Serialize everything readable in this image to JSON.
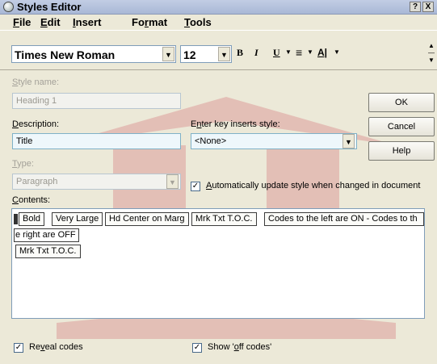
{
  "window": {
    "title": "Styles Editor",
    "help_btn": "?",
    "close_btn": "X"
  },
  "menu": {
    "file": {
      "u": "F",
      "rest": "ile"
    },
    "edit": {
      "u": "E",
      "rest": "dit"
    },
    "insert": {
      "u": "I",
      "rest": "nsert"
    },
    "format": {
      "pre": "Fo",
      "u": "r",
      "rest": "mat"
    },
    "tools": {
      "u": "T",
      "rest": "ools"
    }
  },
  "toolbar": {
    "font": "Times New Roman",
    "size": "12",
    "bold": "B",
    "italic": "I",
    "underline": "U"
  },
  "form": {
    "style_name_label": {
      "u": "S",
      "rest": "tyle name:"
    },
    "style_name_value": "Heading 1",
    "description_label": {
      "u": "D",
      "rest": "escription:"
    },
    "description_value": "Title",
    "enter_key_label": {
      "pre": "E",
      "u": "n",
      "rest": "ter key inserts style:"
    },
    "enter_key_value": "<None>",
    "type_label": {
      "u": "T",
      "rest": "ype:"
    },
    "type_value": "Paragraph",
    "auto_update_label": {
      "u": "A",
      "rest": "utomatically update style when changed in document"
    },
    "auto_update_checked": true,
    "contents_label": {
      "u": "C",
      "rest": "ontents:"
    }
  },
  "buttons": {
    "ok": "OK",
    "cancel": "Cancel",
    "help": "Help"
  },
  "contents": {
    "codes_row1": [
      "Bold",
      "Very Large",
      "Hd Center on Marg",
      "Mrk Txt T.O.C.",
      "Codes to the left are ON - Codes to th"
    ],
    "row2_text": "e right are OFF",
    "codes_row3": [
      "Mrk Txt T.O.C."
    ]
  },
  "options": {
    "reveal_codes": {
      "pre": "Re",
      "u": "v",
      "rest": "eal codes",
      "checked": true
    },
    "show_off_codes": {
      "pre": "Show '",
      "u": "o",
      "rest": "ff codes'",
      "checked": true
    }
  },
  "colors": {
    "titlebar": "#b4c1dc",
    "dialog_bg": "#ece9d8",
    "field_bg": "#eef7fb",
    "watermark": "#c83040"
  }
}
